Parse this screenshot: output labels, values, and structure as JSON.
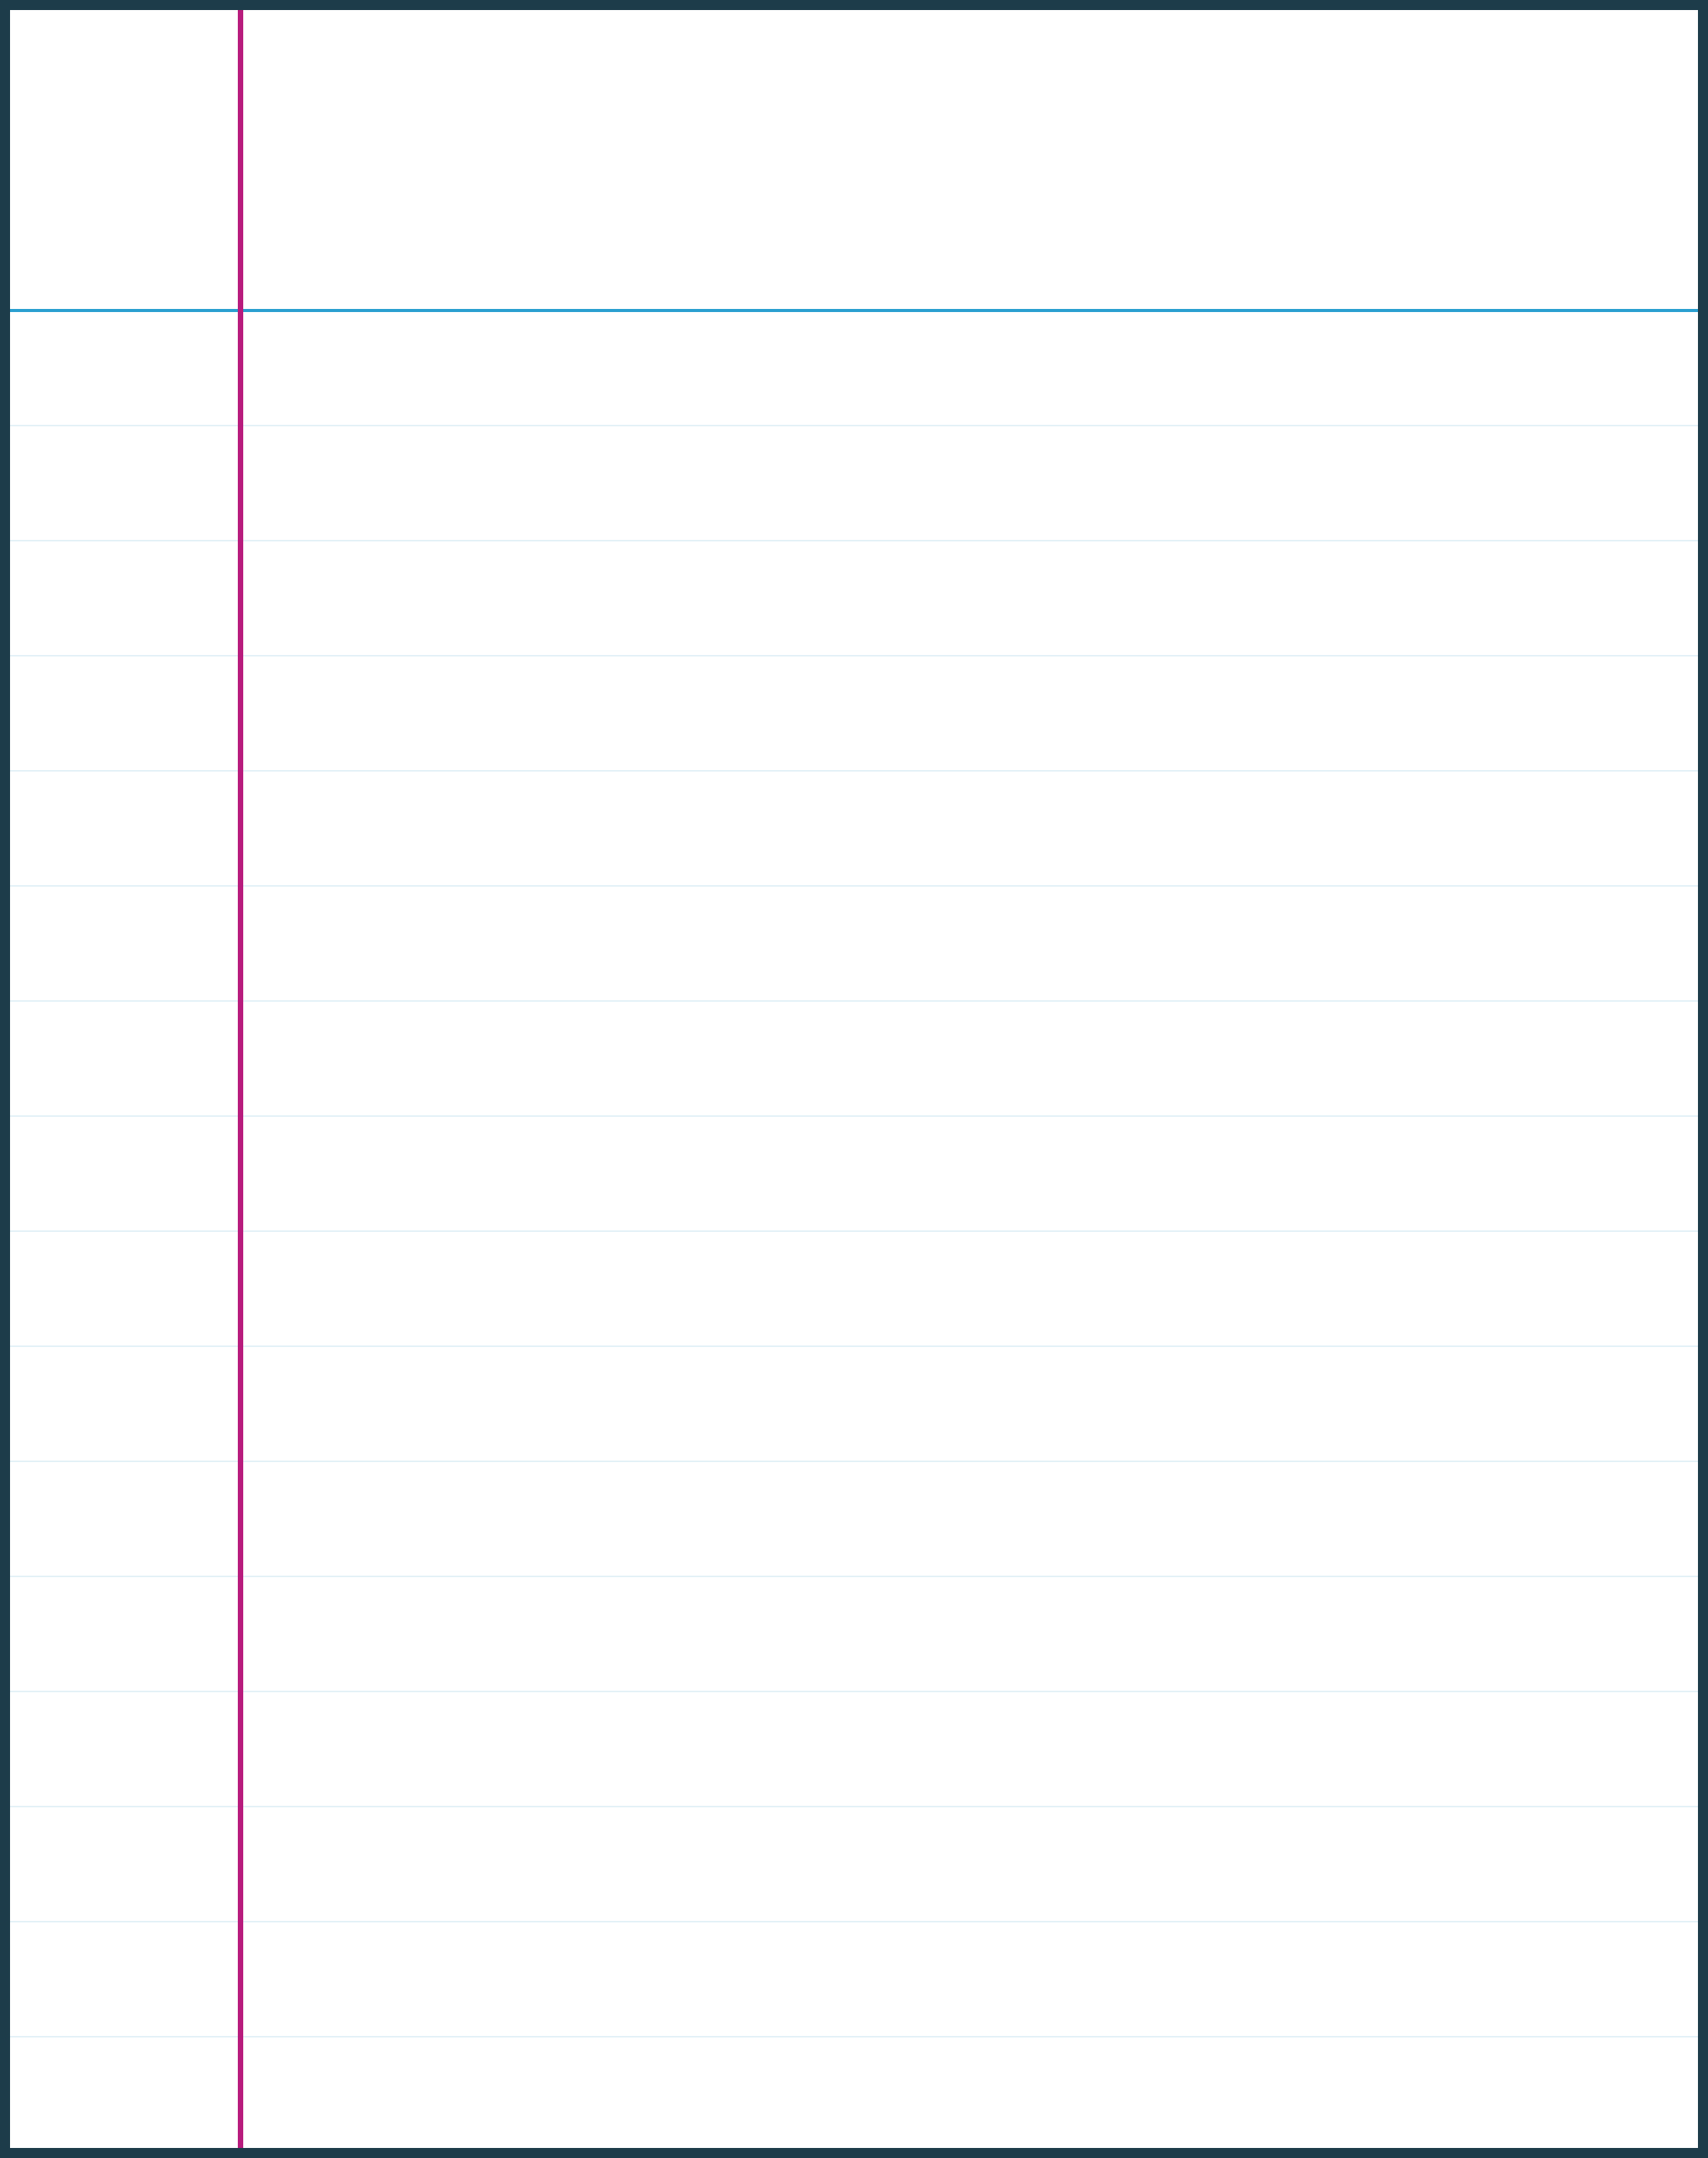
{
  "paper": {
    "style": "ruled notebook page",
    "ruled_line_count": 15,
    "colors": {
      "border": "#1d3c4a",
      "header_line": "#2a9fd0",
      "ruled_line": "#e3f1f7",
      "margin_line": "#b81c7d",
      "background": "#ffffff"
    }
  }
}
